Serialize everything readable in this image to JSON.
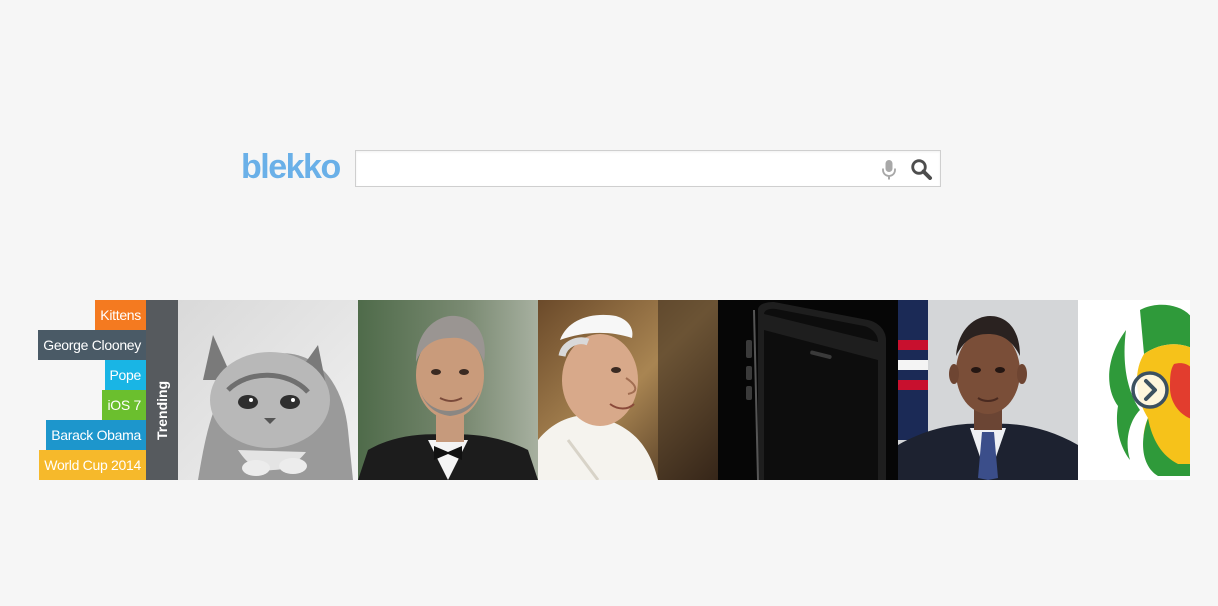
{
  "logo": {
    "text": "blekko",
    "color": "#6ab0e8"
  },
  "search": {
    "value": "",
    "placeholder": "",
    "mic_icon": "microphone-icon",
    "search_icon": "magnifier-icon"
  },
  "trending": {
    "label": "Trending",
    "tags": [
      {
        "label": "Kittens",
        "color": "#f47a20"
      },
      {
        "label": "George Clooney",
        "color": "#4a5a66"
      },
      {
        "label": "Pope",
        "color": "#19b5e5"
      },
      {
        "label": "iOS 7",
        "color": "#6bbf2e"
      },
      {
        "label": "Barack Obama",
        "color": "#1d96cc"
      },
      {
        "label": "World Cup 2014",
        "color": "#f6b92b"
      }
    ],
    "next_icon": "chevron-right-icon"
  }
}
